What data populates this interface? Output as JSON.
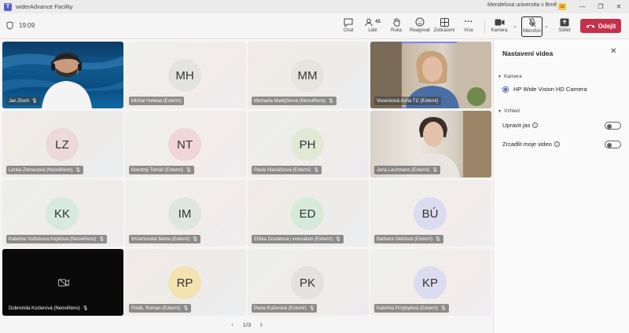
{
  "window": {
    "app_title": "widerAdvance Facility",
    "organization": "Mendelova univerzita v Brně",
    "org_badge": "JZ",
    "minimize": "—",
    "maximize": "❐",
    "close": "✕"
  },
  "toolbar": {
    "timer": "19:09",
    "chat_label": "Chat",
    "people_label": "Lidé",
    "people_count": "45",
    "raise_hand_label": "Ruka",
    "react_label": "Reagovat",
    "view_label": "Zobrazení",
    "more_label": "Více",
    "more_icon": "···",
    "camera_label": "Kamera",
    "mic_label": "Mikrofon",
    "share_label": "Sdílet",
    "leave_label": "Odejít"
  },
  "tiles": [
    {
      "name": "Jan Zloch",
      "type": "photo-pool"
    },
    {
      "name": "Michal Helekal (Externí)",
      "initials": "MH",
      "avatar_color": "#e3e4e2"
    },
    {
      "name": "Michaela Matějčková (Neověřeno)",
      "initials": "MM",
      "avatar_color": "#e6e4dc"
    },
    {
      "name": "Vosecková Anna TC (Externí)",
      "type": "photo-office"
    },
    {
      "name": "Lenka Zemanová (Neověřeno)",
      "initials": "LZ",
      "avatar_color": "#ecd9d8"
    },
    {
      "name": "Novotný Tomáš (Externí)",
      "initials": "NT",
      "avatar_color": "#f0d5d9"
    },
    {
      "name": "Pavla Hlaváčková (Externí)",
      "initials": "PH",
      "avatar_color": "#e2e8d6"
    },
    {
      "name": "Jana Lachmann (Externí)",
      "type": "photo-room"
    },
    {
      "name": "Katerina Vodickova Kepkova (Neověřeno)",
      "initials": "KK",
      "avatar_color": "#d8e9df"
    },
    {
      "name": "Imramovská Marta (Externí)",
      "initials": "IM",
      "avatar_color": "#dde6e0"
    },
    {
      "name": "Eliška Dostálová | enovation (Externí)",
      "initials": "ED",
      "avatar_color": "#d5ead9"
    },
    {
      "name": "Barbora Úlehlová (Externí)",
      "initials": "BÚ",
      "avatar_color": "#dcdcf0"
    },
    {
      "name": "Dobromila Kozlerová (Neověřeno)",
      "type": "black"
    },
    {
      "name": "Polák, Roman (Externí)",
      "initials": "RP",
      "avatar_color": "#f2e3b0"
    },
    {
      "name": "Pavla Kučerová (Externí)",
      "initials": "PK",
      "avatar_color": "#e4e2de"
    },
    {
      "name": "Kateřina Przybylová (Externí)",
      "initials": "KP",
      "avatar_color": "#dcdcf0"
    }
  ],
  "pager": {
    "text": "1/3",
    "prev": "‹",
    "next": "›"
  },
  "panel": {
    "title": "Nastavení videa",
    "camera_section": "Kamera",
    "camera_device": "HP Wide Vision HD Camera",
    "appearance_section": "Vzhled",
    "brightness_label": "Upravit jas",
    "mirror_label": "Zrcadlit moje video",
    "brightness_on": false,
    "mirror_on": false
  }
}
